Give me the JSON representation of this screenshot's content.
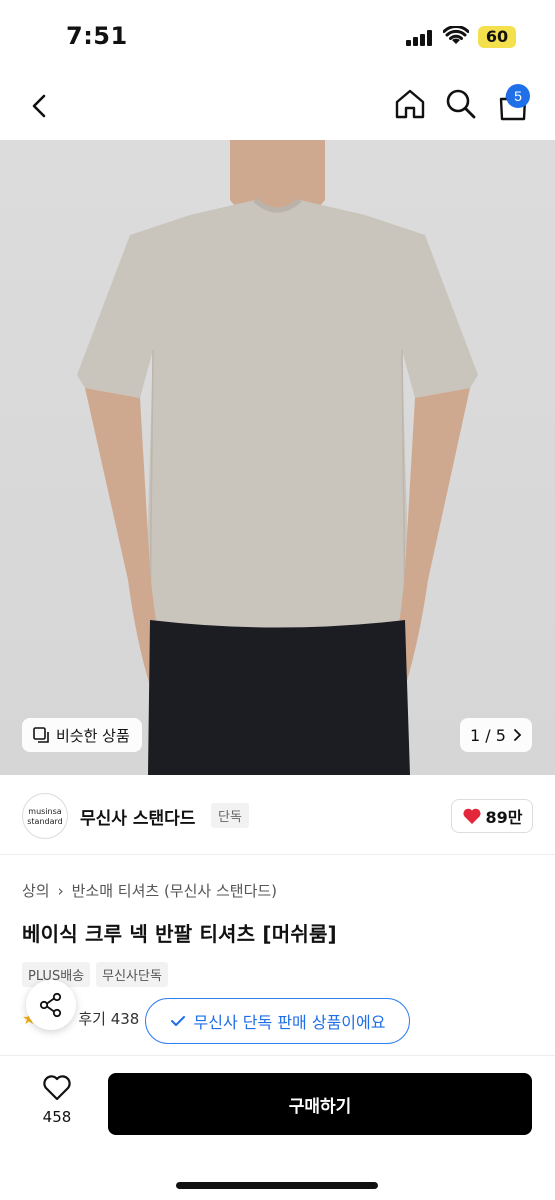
{
  "status_bar": {
    "time": "7:51",
    "battery": "60",
    "battery_color": "#f4e04d"
  },
  "nav": {
    "back_icon": "chevron-left-icon",
    "home_icon": "home-icon",
    "search_icon": "search-icon",
    "cart_icon": "bag-icon",
    "cart_count": "5",
    "accent": "#1f6fe8"
  },
  "hero": {
    "similar_label": "비슷한 상품",
    "pager": "1 / 5"
  },
  "brand": {
    "logo_text_line1": "musinsa",
    "logo_text_line2": "standard",
    "name": "무신사 스탠다드",
    "exclusive_tag": "단독",
    "likes": "89만"
  },
  "product": {
    "breadcrumb": [
      "상의",
      "반소매 티셔츠 (무신사 스탠다드)"
    ],
    "title": "베이식 크루 넥 반팔 티셔츠 [머쉬룸]",
    "tags": [
      "PLUS배송",
      "무신사단독"
    ],
    "review_label": "후기 438"
  },
  "toast": {
    "text": "무신사 단독 판매 상품이에요"
  },
  "bottom": {
    "wish_count": "458",
    "buy_label": "구매하기"
  }
}
